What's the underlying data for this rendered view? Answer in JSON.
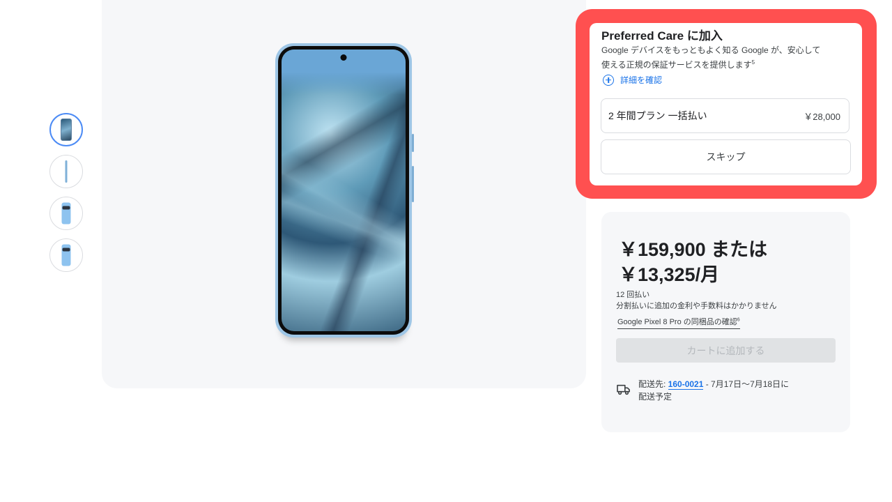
{
  "thumbnails": [
    {
      "view": "front",
      "active": true
    },
    {
      "view": "side",
      "active": false
    },
    {
      "view": "back",
      "active": false
    },
    {
      "view": "back-angle",
      "active": false
    }
  ],
  "care": {
    "title": "Preferred Care に加入",
    "description_line1": "Google デバイスをもっともよく知る Google が、安心して",
    "description_line2": "使える正規の保証サービスを提供します",
    "footnote": "5",
    "details_link": "詳細を確認",
    "plan_name": "2 年間プラン 一括払い",
    "plan_price": "￥28,000",
    "skip_label": "スキップ",
    "highlight_color": "#ff5050"
  },
  "purchase": {
    "price_line1": "￥159,900 または",
    "price_line2": "￥13,325/月",
    "installments_count": "12 回払い",
    "installments_note": "分割払いに追加の金利や手数料はかかりません",
    "included_link": "Google Pixel 8 Pro の同梱品の確認",
    "included_footnote": "6",
    "cart_button": "カートに追加する",
    "delivery_prefix": "配送先: ",
    "zip_code": "160-0021",
    "delivery_dates": " - 7月17日〜7月18日に",
    "delivery_suffix": "配送予定",
    "accent_color": "#1a73e8"
  }
}
